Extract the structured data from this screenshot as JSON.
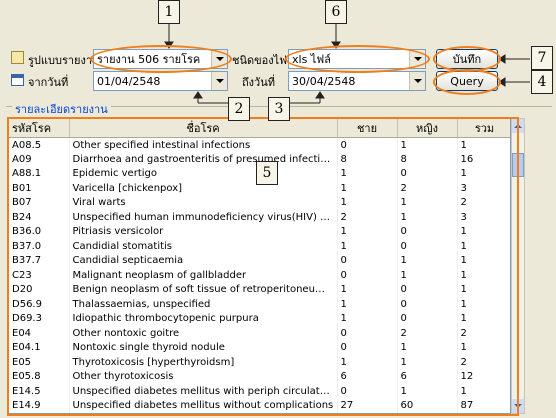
{
  "form": {
    "report_format_label": "รูปแบบรายงาน",
    "report_format_value": "รายงาน 506 รายโรค",
    "file_type_label": "ชนิดของไฟล์",
    "file_type_value": "xls ไฟล์",
    "from_date_label": "จากวันที่",
    "from_date_value": "01/04/2548",
    "to_date_label": "ถึงวันที่",
    "to_date_value": "30/04/2548",
    "save_label": "บันทึก",
    "query_label": "Query"
  },
  "group": {
    "title": "รายละเอียดรายงาน"
  },
  "callouts": [
    "1",
    "6",
    "7",
    "4",
    "2",
    "3",
    "5"
  ],
  "table": {
    "headers": [
      "รหัสโรค",
      "ชื่อโรค",
      "ชาย",
      "หญิง",
      "รวม"
    ],
    "rows": [
      [
        "A08.5",
        "Other specified intestinal infections",
        "0",
        "1",
        "1"
      ],
      [
        "A09",
        "Diarrhoea and gastroenteritis of presumed infectious or...",
        "8",
        "8",
        "16"
      ],
      [
        "A88.1",
        "Epidemic vertigo",
        "1",
        "0",
        "1"
      ],
      [
        "B01",
        "Varicella [chickenpox]",
        "1",
        "2",
        "3"
      ],
      [
        "B07",
        "Viral warts",
        "1",
        "1",
        "2"
      ],
      [
        "B24",
        "Unspecified human immunodeficiency virus(HIV) disease",
        "2",
        "1",
        "3"
      ],
      [
        "B36.0",
        "Pitriasis versicolor",
        "1",
        "0",
        "1"
      ],
      [
        "B37.0",
        "Candidial stomatitis",
        "1",
        "0",
        "1"
      ],
      [
        "B37.7",
        "Candidial septicaemia",
        "0",
        "1",
        "1"
      ],
      [
        "C23",
        "Malignant neoplasm of gallbladder",
        "0",
        "1",
        "1"
      ],
      [
        "D20",
        "Benign neoplasm of soft tissue of retroperitoneum and ...",
        "1",
        "0",
        "1"
      ],
      [
        "D56.9",
        "Thalassaemias, unspecified",
        "1",
        "0",
        "1"
      ],
      [
        "D69.3",
        "Idiopathic thrombocytopenic purpura",
        "1",
        "0",
        "1"
      ],
      [
        "E04",
        "Other nontoxic goitre",
        "0",
        "2",
        "2"
      ],
      [
        "E04.1",
        "Nontoxic single thyroid nodule",
        "0",
        "1",
        "1"
      ],
      [
        "E05",
        "Thyrotoxicosis [hyperthyroidsm]",
        "1",
        "1",
        "2"
      ],
      [
        "E05.8",
        "Other thyrotoxicosis",
        "6",
        "6",
        "12"
      ],
      [
        "E14.5",
        "Unspecified diabetes mellitus with periph circulatory comps",
        "0",
        "1",
        "1"
      ],
      [
        "E14.9",
        "Unspecified diabetes mellitus without complications",
        "27",
        "60",
        "87"
      ]
    ]
  },
  "colors": {
    "accent_orange": "#f07e1c",
    "title_blue": "#0046d5"
  }
}
